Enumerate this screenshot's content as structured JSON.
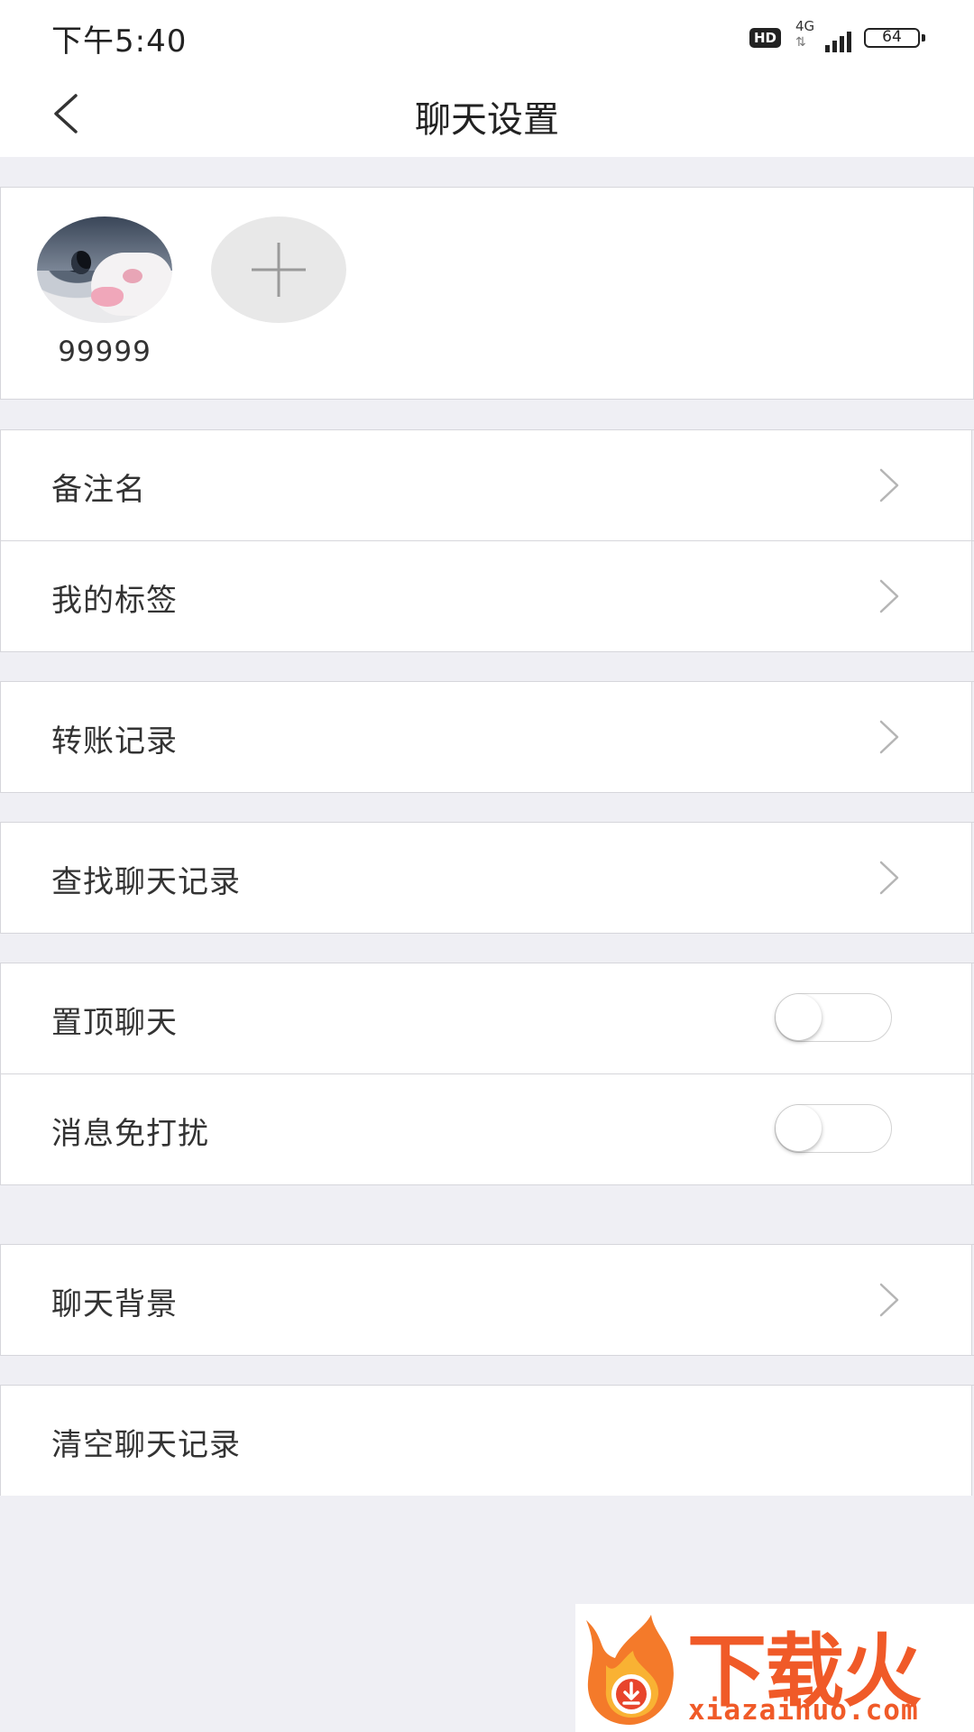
{
  "status_bar": {
    "time": "下午5:40",
    "hd": "HD",
    "network": "4G",
    "battery": "64"
  },
  "nav": {
    "title": "聊天设置",
    "back_icon": "chevron-left-icon"
  },
  "members": [
    {
      "name": "99999"
    }
  ],
  "add_member_icon": "plus-icon",
  "rows": {
    "remark": "备注名",
    "tags": "我的标签",
    "transfer": "转账记录",
    "search_history": "查找聊天记录",
    "pin_chat": "置顶聊天",
    "mute": "消息免打扰",
    "background": "聊天背景",
    "clear_history": "清空聊天记录"
  },
  "toggles": {
    "pin_chat": false,
    "mute": false
  },
  "watermark": {
    "brand": "下载火",
    "url": "xiazaihuo.com"
  },
  "colors": {
    "background": "#efeff4",
    "surface": "#ffffff",
    "watermark": "#f05a28"
  }
}
